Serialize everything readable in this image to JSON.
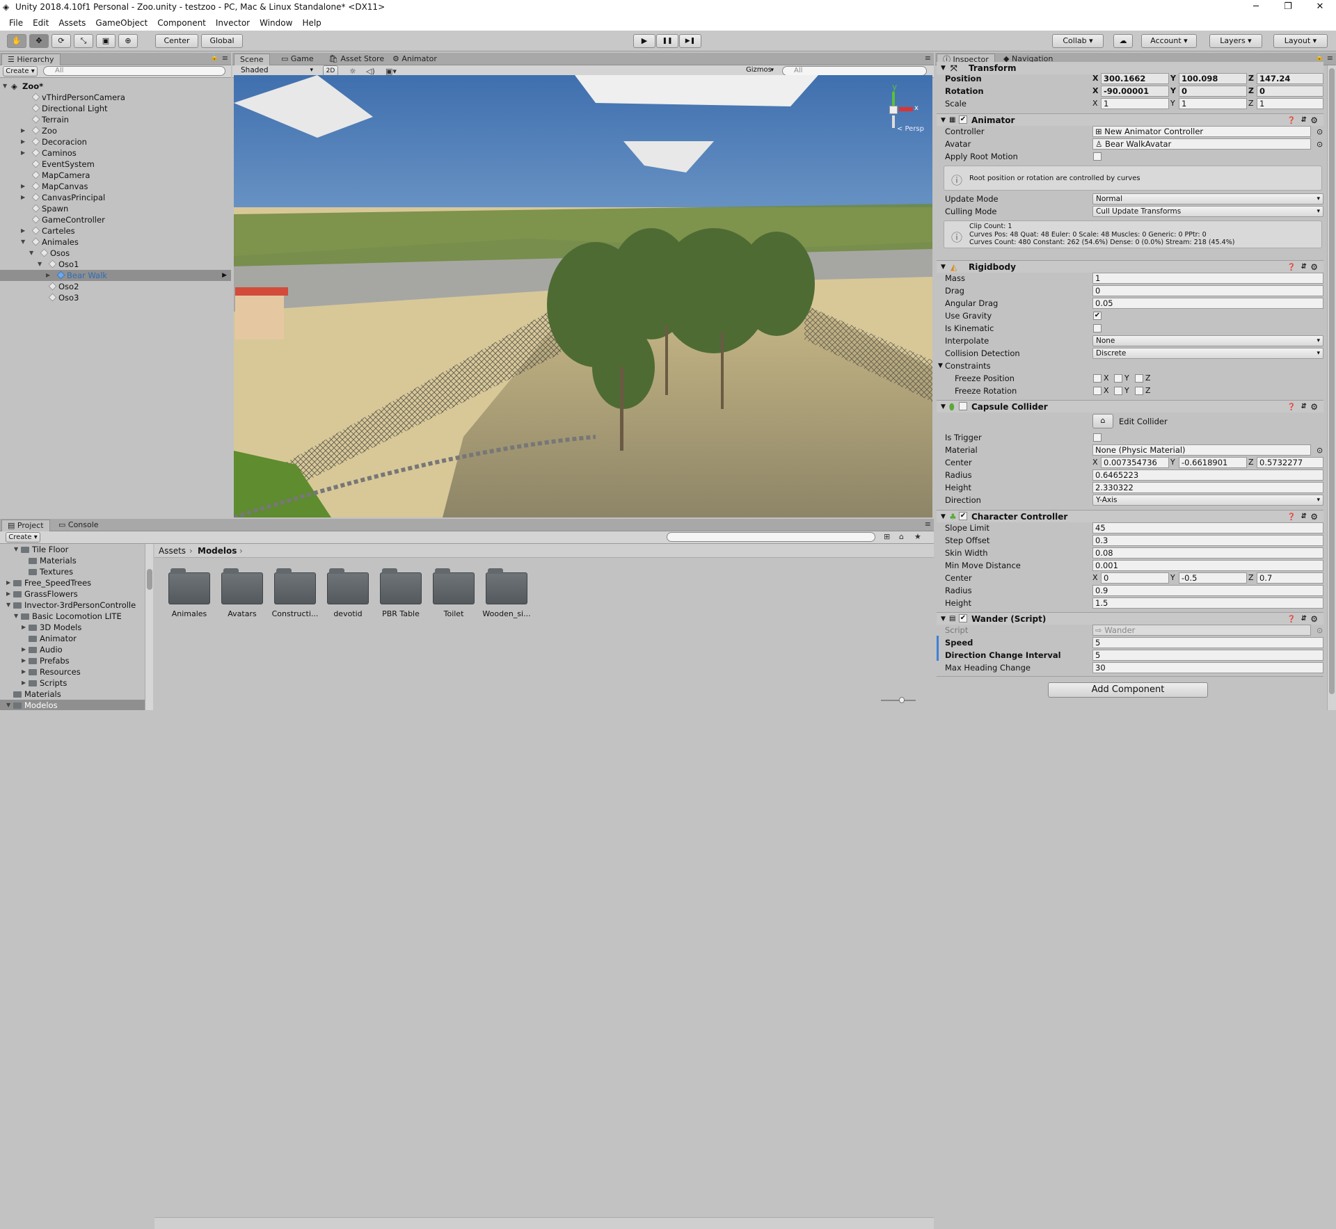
{
  "window": {
    "title": "Unity 2018.4.10f1 Personal - Zoo.unity - testzoo - PC, Mac & Linux Standalone* <DX11>",
    "min": "─",
    "max": "❐",
    "close": "✕"
  },
  "menu": [
    "File",
    "Edit",
    "Assets",
    "GameObject",
    "Component",
    "Invector",
    "Window",
    "Help"
  ],
  "toolbar": {
    "center": "Center",
    "global": "Global",
    "play": "▶",
    "pause": "❚❚",
    "step": "▶❚",
    "collab": "Collab",
    "cloud": "☁",
    "account": "Account",
    "layers": "Layers",
    "layout": "Layout"
  },
  "hierarchy": {
    "tab": "Hierarchy",
    "create": "Create",
    "search_placeholder": "All",
    "scene": "Zoo*",
    "items": [
      {
        "label": "vThirdPersonCamera",
        "depth": 1,
        "arrow": false
      },
      {
        "label": "Directional Light",
        "depth": 1,
        "arrow": false
      },
      {
        "label": "Terrain",
        "depth": 1,
        "arrow": false
      },
      {
        "label": "Zoo",
        "depth": 1,
        "arrow": true
      },
      {
        "label": "Decoracion",
        "depth": 1,
        "arrow": true
      },
      {
        "label": "Caminos",
        "depth": 1,
        "arrow": true
      },
      {
        "label": "EventSystem",
        "depth": 1,
        "arrow": false
      },
      {
        "label": "MapCamera",
        "depth": 1,
        "arrow": false
      },
      {
        "label": "MapCanvas",
        "depth": 1,
        "arrow": true
      },
      {
        "label": "CanvasPrincipal",
        "depth": 1,
        "arrow": true
      },
      {
        "label": "Spawn",
        "depth": 1,
        "arrow": false
      },
      {
        "label": "GameController",
        "depth": 1,
        "arrow": false
      },
      {
        "label": "Carteles",
        "depth": 1,
        "arrow": true
      },
      {
        "label": "Animales",
        "depth": 1,
        "arrow": true,
        "open": true
      },
      {
        "label": "Osos",
        "depth": 2,
        "arrow": true,
        "open": true
      },
      {
        "label": "Oso1",
        "depth": 3,
        "arrow": true,
        "open": true
      },
      {
        "label": "Bear Walk",
        "depth": 4,
        "arrow": true,
        "selected": true
      },
      {
        "label": "Oso2",
        "depth": 3,
        "arrow": false
      },
      {
        "label": "Oso3",
        "depth": 3,
        "arrow": false
      }
    ]
  },
  "scene_view": {
    "tabs": [
      "Scene",
      "Game",
      "Asset Store",
      "Animator"
    ],
    "shading": "Shaded",
    "mode2d": "2D",
    "gizmos": "Gizmos",
    "search_placeholder": "All",
    "persp": "< Persp",
    "axis_x": "x",
    "axis_y": "y"
  },
  "project": {
    "tabs": [
      "Project",
      "Console"
    ],
    "create": "Create",
    "breadcrumb": [
      "Assets",
      "Modelos"
    ],
    "tree": [
      {
        "label": "Tile Floor",
        "depth": 2,
        "open": true
      },
      {
        "label": "Materials",
        "depth": 3
      },
      {
        "label": "Textures",
        "depth": 3
      },
      {
        "label": "Free_SpeedTrees",
        "depth": 1,
        "arrow": true
      },
      {
        "label": "GrassFlowers",
        "depth": 1,
        "arrow": true
      },
      {
        "label": "Invector-3rdPersonControlle",
        "depth": 1,
        "open": true
      },
      {
        "label": "Basic Locomotion LITE",
        "depth": 2,
        "open": true
      },
      {
        "label": "3D Models",
        "depth": 3,
        "arrow": true
      },
      {
        "label": "Animator",
        "depth": 3
      },
      {
        "label": "Audio",
        "depth": 3,
        "arrow": true
      },
      {
        "label": "Prefabs",
        "depth": 3,
        "arrow": true
      },
      {
        "label": "Resources",
        "depth": 3,
        "arrow": true
      },
      {
        "label": "Scripts",
        "depth": 3,
        "arrow": true
      },
      {
        "label": "Materials",
        "depth": 1
      },
      {
        "label": "Modelos",
        "depth": 1,
        "open": true,
        "selected": true
      }
    ],
    "folders": [
      "Animales",
      "Avatars",
      "Constructi...",
      "devotid",
      "PBR Table",
      "Toilet",
      "Wooden_si..."
    ]
  },
  "inspector": {
    "tabs": [
      "Inspector",
      "Navigation"
    ],
    "transform": {
      "title": "Transform",
      "position_label": "Position",
      "rotation_label": "Rotation",
      "scale_label": "Scale",
      "position": [
        "300.1662",
        "100.098",
        "147.24"
      ],
      "rotation": [
        "-90.00001",
        "0",
        "0"
      ],
      "scale": [
        "1",
        "1",
        "1"
      ]
    },
    "animator": {
      "title": "Animator",
      "controller_label": "Controller",
      "controller": "New Animator Controller",
      "avatar_label": "Avatar",
      "avatar": "Bear WalkAvatar",
      "apply_root_motion": "Apply Root Motion",
      "info": "Root position or rotation are controlled by curves",
      "update_mode_label": "Update Mode",
      "update_mode": "Normal",
      "culling_mode_label": "Culling Mode",
      "culling_mode": "Cull Update Transforms",
      "clip_info": [
        "Clip Count: 1",
        "Curves Pos: 48 Quat: 48 Euler: 0 Scale: 48 Muscles: 0 Generic: 0 PPtr: 0",
        "Curves Count: 480 Constant: 262 (54.6%) Dense: 0 (0.0%) Stream: 218 (45.4%)"
      ]
    },
    "rigidbody": {
      "title": "Rigidbody",
      "mass_label": "Mass",
      "mass": "1",
      "drag_label": "Drag",
      "drag": "0",
      "angular_drag_label": "Angular Drag",
      "angular_drag": "0.05",
      "use_gravity": "Use Gravity",
      "is_kinematic": "Is Kinematic",
      "interpolate_label": "Interpolate",
      "interpolate": "None",
      "collision_label": "Collision Detection",
      "collision": "Discrete",
      "constraints": "Constraints",
      "freeze_position": "Freeze Position",
      "freeze_rotation": "Freeze Rotation"
    },
    "capsule": {
      "title": "Capsule Collider",
      "edit": "Edit Collider",
      "is_trigger": "Is Trigger",
      "material_label": "Material",
      "material": "None (Physic Material)",
      "center_label": "Center",
      "center": [
        "0.007354736",
        "-0.6618901",
        "0.5732277"
      ],
      "radius_label": "Radius",
      "radius": "0.6465223",
      "height_label": "Height",
      "height": "2.330322",
      "direction_label": "Direction",
      "direction": "Y-Axis"
    },
    "character_controller": {
      "title": "Character Controller",
      "slope_label": "Slope Limit",
      "slope": "45",
      "step_label": "Step Offset",
      "step": "0.3",
      "skin_label": "Skin Width",
      "skin": "0.08",
      "minmove_label": "Min Move Distance",
      "minmove": "0.001",
      "center_label": "Center",
      "center": [
        "0",
        "-0.5",
        "0.7"
      ],
      "radius_label": "Radius",
      "radius": "0.9",
      "height_label": "Height",
      "height": "1.5"
    },
    "wander": {
      "title": "Wander (Script)",
      "script_label": "Script",
      "script": "Wander",
      "speed_label": "Speed",
      "speed": "5",
      "interval_label": "Direction Change Interval",
      "interval": "5",
      "heading_label": "Max Heading Change",
      "heading": "30"
    },
    "add_component": "Add Component"
  }
}
